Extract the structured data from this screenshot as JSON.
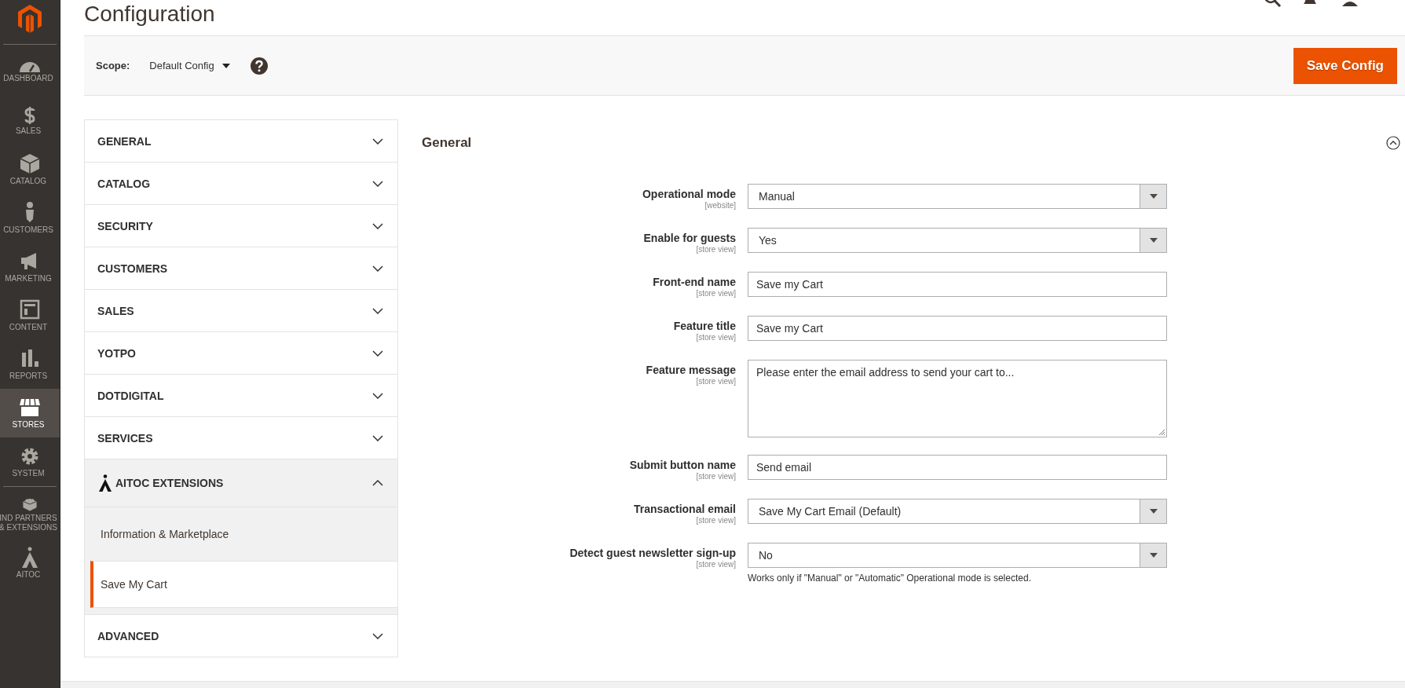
{
  "nav": {
    "items": [
      {
        "label": "DASHBOARD",
        "selected": false
      },
      {
        "label": "SALES",
        "selected": false
      },
      {
        "label": "CATALOG",
        "selected": false
      },
      {
        "label": "CUSTOMERS",
        "selected": false
      },
      {
        "label": "MARKETING",
        "selected": false
      },
      {
        "label": "CONTENT",
        "selected": false
      },
      {
        "label": "REPORTS",
        "selected": false
      },
      {
        "label": "STORES",
        "selected": true
      },
      {
        "label": "SYSTEM",
        "selected": false
      },
      {
        "label": "IND PARTNERS & EXTENSIONS",
        "selected": false
      },
      {
        "label": "AITOC",
        "selected": false
      }
    ]
  },
  "header": {
    "title": "Configuration"
  },
  "scope_bar": {
    "label": "Scope:",
    "value": "Default Config",
    "button": "Save Config"
  },
  "sections": [
    {
      "label": "GENERAL",
      "expanded": false
    },
    {
      "label": "CATALOG",
      "expanded": false
    },
    {
      "label": "SECURITY",
      "expanded": false
    },
    {
      "label": "CUSTOMERS",
      "expanded": false
    },
    {
      "label": "SALES",
      "expanded": false
    },
    {
      "label": "YOTPO",
      "expanded": false
    },
    {
      "label": "DOTDIGITAL",
      "expanded": false
    },
    {
      "label": "SERVICES",
      "expanded": false
    },
    {
      "label": "AITOC EXTENSIONS",
      "expanded": true,
      "children": [
        {
          "label": "Information & Marketplace",
          "selected": false
        },
        {
          "label": "Save My Cart",
          "selected": true
        }
      ]
    },
    {
      "label": "ADVANCED",
      "expanded": false
    }
  ],
  "group": {
    "title": "General",
    "expanded": true,
    "fields": [
      {
        "kind": "select",
        "label": "Operational mode",
        "scope": "[website]",
        "value": "Manual"
      },
      {
        "kind": "select",
        "label": "Enable for guests",
        "scope": "[store view]",
        "value": "Yes"
      },
      {
        "kind": "text",
        "label": "Front-end name",
        "scope": "[store view]",
        "value": "Save my Cart"
      },
      {
        "kind": "text",
        "label": "Feature title",
        "scope": "[store view]",
        "value": "Save my Cart"
      },
      {
        "kind": "textarea",
        "label": "Feature message",
        "scope": "[store view]",
        "value": "Please enter the email address to send your cart to..."
      },
      {
        "kind": "text",
        "label": "Submit button name",
        "scope": "[store view]",
        "value": "Send email"
      },
      {
        "kind": "select",
        "label": "Transactional email",
        "scope": "[store view]",
        "value": "Save My Cart Email (Default)"
      },
      {
        "kind": "select",
        "label": "Detect guest newsletter sign-up",
        "scope": "[store view]",
        "value": "No",
        "note": "Works only if \"Manual\" or \"Automatic\" Operational mode is selected."
      }
    ]
  }
}
